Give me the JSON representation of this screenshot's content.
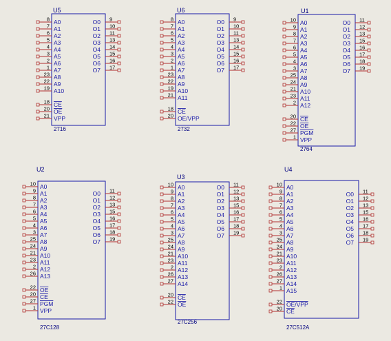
{
  "title": "EPROM schematic symbols",
  "colors": {
    "background": "#ebe9e2",
    "body": "#1a1aa8",
    "label": "#1a1aa8",
    "pin": "#b03030",
    "pin_number": "#000000",
    "ref": "#000080"
  },
  "components": [
    {
      "ref": "U5",
      "part": "2716",
      "left": [
        {
          "num": "8",
          "name": "A0"
        },
        {
          "num": "7",
          "name": "A1"
        },
        {
          "num": "6",
          "name": "A2"
        },
        {
          "num": "5",
          "name": "A3"
        },
        {
          "num": "4",
          "name": "A4"
        },
        {
          "num": "3",
          "name": "A5"
        },
        {
          "num": "2",
          "name": "A6"
        },
        {
          "num": "1",
          "name": "A7"
        },
        {
          "num": "23",
          "name": "A8"
        },
        {
          "num": "22",
          "name": "A9"
        },
        {
          "num": "19",
          "name": "A10"
        },
        {
          "gap": true
        },
        {
          "num": "18",
          "name": "CE",
          "bar": true
        },
        {
          "num": "20",
          "name": "OE",
          "bar": true
        },
        {
          "num": "21",
          "name": "VPP"
        }
      ],
      "right": [
        {
          "num": "9",
          "name": "O0"
        },
        {
          "num": "10",
          "name": "O1"
        },
        {
          "num": "11",
          "name": "O2"
        },
        {
          "num": "13",
          "name": "O3"
        },
        {
          "num": "14",
          "name": "O4"
        },
        {
          "num": "15",
          "name": "O5"
        },
        {
          "num": "16",
          "name": "O6"
        },
        {
          "num": "17",
          "name": "O7"
        }
      ]
    },
    {
      "ref": "U6",
      "part": "2732",
      "left": [
        {
          "num": "8",
          "name": "A0"
        },
        {
          "num": "7",
          "name": "A1"
        },
        {
          "num": "6",
          "name": "A2"
        },
        {
          "num": "5",
          "name": "A3"
        },
        {
          "num": "4",
          "name": "A4"
        },
        {
          "num": "3",
          "name": "A5"
        },
        {
          "num": "2",
          "name": "A6"
        },
        {
          "num": "1",
          "name": "A7"
        },
        {
          "num": "23",
          "name": "A8"
        },
        {
          "num": "22",
          "name": "A9"
        },
        {
          "num": "19",
          "name": "A10"
        },
        {
          "num": "21",
          "name": "A11"
        },
        {
          "gap": true
        },
        {
          "num": "18",
          "name": "CE",
          "bar": true
        },
        {
          "num": "20",
          "name": "OE/VPP"
        }
      ],
      "right": [
        {
          "num": "9",
          "name": "O0"
        },
        {
          "num": "10",
          "name": "O1"
        },
        {
          "num": "11",
          "name": "O2"
        },
        {
          "num": "13",
          "name": "O3"
        },
        {
          "num": "14",
          "name": "O4"
        },
        {
          "num": "15",
          "name": "O5"
        },
        {
          "num": "16",
          "name": "O6"
        },
        {
          "num": "17",
          "name": "O7"
        }
      ]
    },
    {
      "ref": "U1",
      "part": "2764",
      "left": [
        {
          "num": "10",
          "name": "A0"
        },
        {
          "num": "9",
          "name": "A1"
        },
        {
          "num": "8",
          "name": "A2"
        },
        {
          "num": "7",
          "name": "A3"
        },
        {
          "num": "6",
          "name": "A4"
        },
        {
          "num": "5",
          "name": "A5"
        },
        {
          "num": "4",
          "name": "A6"
        },
        {
          "num": "3",
          "name": "A7"
        },
        {
          "num": "25",
          "name": "A8"
        },
        {
          "num": "24",
          "name": "A9"
        },
        {
          "num": "21",
          "name": "A10"
        },
        {
          "num": "23",
          "name": "A11"
        },
        {
          "num": "2",
          "name": "A12"
        },
        {
          "gap": true
        },
        {
          "num": "20",
          "name": "CE",
          "bar": true
        },
        {
          "num": "22",
          "name": "OE",
          "bar": true
        },
        {
          "num": "27",
          "name": "PGM",
          "bar": true
        },
        {
          "num": "1",
          "name": "VPP"
        }
      ],
      "right": [
        {
          "num": "11",
          "name": "O0"
        },
        {
          "num": "12",
          "name": "O1"
        },
        {
          "num": "13",
          "name": "O2"
        },
        {
          "num": "15",
          "name": "O3"
        },
        {
          "num": "16",
          "name": "O4"
        },
        {
          "num": "17",
          "name": "O5"
        },
        {
          "num": "18",
          "name": "O6"
        },
        {
          "num": "19",
          "name": "O7"
        }
      ]
    },
    {
      "ref": "U2",
      "part": "27C128",
      "left": [
        {
          "num": "10",
          "name": "A0"
        },
        {
          "num": "9",
          "name": "A1"
        },
        {
          "num": "8",
          "name": "A2"
        },
        {
          "num": "7",
          "name": "A3"
        },
        {
          "num": "6",
          "name": "A4"
        },
        {
          "num": "5",
          "name": "A5"
        },
        {
          "num": "4",
          "name": "A6"
        },
        {
          "num": "3",
          "name": "A7"
        },
        {
          "num": "25",
          "name": "A8"
        },
        {
          "num": "24",
          "name": "A9"
        },
        {
          "num": "21",
          "name": "A10"
        },
        {
          "num": "23",
          "name": "A11"
        },
        {
          "num": "2",
          "name": "A12"
        },
        {
          "num": "26",
          "name": "A13"
        },
        {
          "gap": true
        },
        {
          "num": "22",
          "name": "OE",
          "bar": true
        },
        {
          "num": "20",
          "name": "CE",
          "bar": true
        },
        {
          "num": "27",
          "name": "PGM",
          "bar": true
        },
        {
          "num": "1",
          "name": "VPP"
        }
      ],
      "right": [
        {
          "gap": true
        },
        {
          "num": "11",
          "name": "O0"
        },
        {
          "num": "12",
          "name": "O1"
        },
        {
          "num": "13",
          "name": "O2"
        },
        {
          "num": "15",
          "name": "O3"
        },
        {
          "num": "16",
          "name": "O4"
        },
        {
          "num": "17",
          "name": "O5"
        },
        {
          "num": "18",
          "name": "O6"
        },
        {
          "num": "19",
          "name": "O7"
        }
      ]
    },
    {
      "ref": "U3",
      "part": "27C256",
      "left": [
        {
          "num": "10",
          "name": "A0"
        },
        {
          "num": "9",
          "name": "A1"
        },
        {
          "num": "8",
          "name": "A2"
        },
        {
          "num": "7",
          "name": "A3"
        },
        {
          "num": "6",
          "name": "A4"
        },
        {
          "num": "5",
          "name": "A5"
        },
        {
          "num": "4",
          "name": "A6"
        },
        {
          "num": "3",
          "name": "A7"
        },
        {
          "num": "25",
          "name": "A8"
        },
        {
          "num": "24",
          "name": "A9"
        },
        {
          "num": "21",
          "name": "A10"
        },
        {
          "num": "23",
          "name": "A11"
        },
        {
          "num": "2",
          "name": "A12"
        },
        {
          "num": "26",
          "name": "A13"
        },
        {
          "num": "27",
          "name": "A14"
        },
        {
          "gap": true
        },
        {
          "num": "20",
          "name": "CE",
          "bar": true
        },
        {
          "num": "22",
          "name": "OE",
          "bar": true
        }
      ],
      "right": [
        {
          "num": "11",
          "name": "O0"
        },
        {
          "num": "12",
          "name": "O1"
        },
        {
          "num": "13",
          "name": "O2"
        },
        {
          "num": "15",
          "name": "O3"
        },
        {
          "num": "16",
          "name": "O4"
        },
        {
          "num": "17",
          "name": "O5"
        },
        {
          "num": "18",
          "name": "O6"
        },
        {
          "num": "19",
          "name": "O7"
        }
      ]
    },
    {
      "ref": "U4",
      "part": "27C512A",
      "left": [
        {
          "num": "10",
          "name": "A0"
        },
        {
          "num": "9",
          "name": "A1"
        },
        {
          "num": "8",
          "name": "A2"
        },
        {
          "num": "7",
          "name": "A3"
        },
        {
          "num": "6",
          "name": "A4"
        },
        {
          "num": "5",
          "name": "A5"
        },
        {
          "num": "4",
          "name": "A6"
        },
        {
          "num": "3",
          "name": "A7"
        },
        {
          "num": "25",
          "name": "A8"
        },
        {
          "num": "24",
          "name": "A9"
        },
        {
          "num": "21",
          "name": "A10"
        },
        {
          "num": "23",
          "name": "A11"
        },
        {
          "num": "2",
          "name": "A12"
        },
        {
          "num": "26",
          "name": "A13"
        },
        {
          "num": "27",
          "name": "A14"
        },
        {
          "num": "1",
          "name": "A15"
        },
        {
          "gap": true
        },
        {
          "num": "22",
          "name": "OE/VPP",
          "bar": true
        },
        {
          "num": "20",
          "name": "CE",
          "bar": true
        }
      ],
      "right": [
        {
          "gap": true
        },
        {
          "num": "11",
          "name": "O0"
        },
        {
          "num": "12",
          "name": "O1"
        },
        {
          "num": "13",
          "name": "O2"
        },
        {
          "num": "15",
          "name": "O3"
        },
        {
          "num": "16",
          "name": "O4"
        },
        {
          "num": "17",
          "name": "O5"
        },
        {
          "num": "18",
          "name": "O6"
        },
        {
          "num": "19",
          "name": "O7"
        }
      ]
    }
  ]
}
